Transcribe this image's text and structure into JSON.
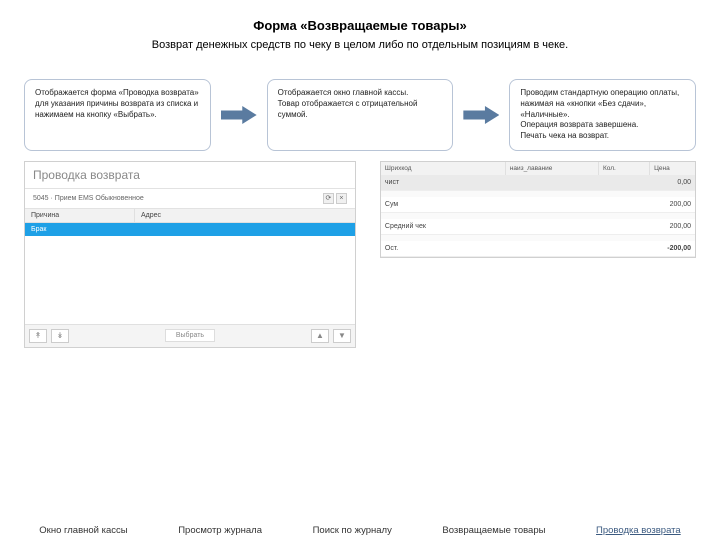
{
  "title": "Форма «Возвращаемые товары»",
  "subtitle": "Возврат денежных средств по чеку в целом либо по отдельным позициям в чеке.",
  "callouts": {
    "c1": "Отображается форма «Проводка возврата» для указания причины возврата из списка и нажимаем на кнопку «Выбрать».",
    "c2": "Отображается окно главной кассы.\nТовар отображается с отрицательной суммой.",
    "c3": "Проводим стандартную операцию оплаты, нажимая на «кнопки «Без сдачи», «Наличные».\nОперация возврата завершена.\nПечать чека на возврат."
  },
  "left_panel": {
    "heading": "Проводка возврата",
    "sub": "5045 · Прием EMS Обыкновенное",
    "columns": {
      "a": "Причина",
      "b": "Адрес"
    },
    "row": "Брак"
  },
  "foot_label": "Выбрать",
  "right_panel": {
    "head": {
      "a": "Шрихкод",
      "b": "наиз_лавание",
      "c": "Кол.",
      "d": "Цена"
    },
    "rows": [
      {
        "label": "чист",
        "value": "0,00"
      },
      {
        "label": "Сум",
        "value": "200,00"
      },
      {
        "label": "Средний чек",
        "value": "200,00"
      },
      {
        "label": "Ост.",
        "value": "-200,00"
      }
    ]
  },
  "nav": {
    "a": "Окно главной кассы",
    "b": "Просмотр журнала",
    "c": "Поиск по журналу",
    "d": "Возвращаемые товары",
    "e": "Проводка возврата"
  }
}
